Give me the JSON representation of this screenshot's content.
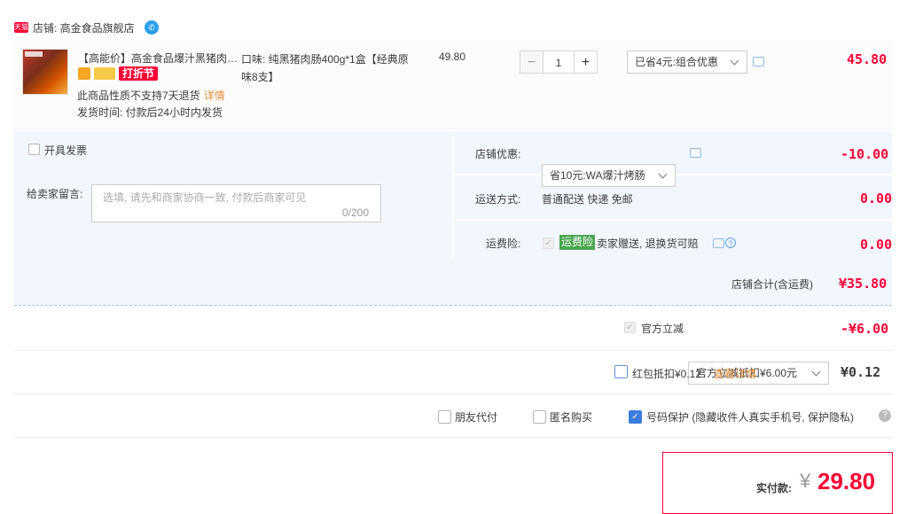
{
  "shop": {
    "badge": "天猫",
    "label": "店铺: 高金食品旗舰店",
    "ww_icon": "ww-chat-icon"
  },
  "item": {
    "title": "【高能价】高金食品爆汁黑猪肉…",
    "festival_tag": "打折节",
    "note_return": "此商品性质不支持7天退货",
    "detail_link": "详情",
    "delivery": "发货时间: 付款后24小时内发货",
    "flavor": "口味: 纯黑猪肉肠400g*1盒【经典原味8支】",
    "unit_price": "49.80",
    "qty_minus": "−",
    "qty": "1",
    "qty_plus": "+",
    "promo_select": "已省4元:组合优惠",
    "subtotal": "45.80"
  },
  "invoice_label": "开具发票",
  "message": {
    "label": "给卖家留言:",
    "placeholder": "选填, 请先和商家协商一致, 付款后商家可见",
    "counter": "0/200"
  },
  "shop_discount": {
    "label": "店铺优惠:",
    "select": "省10元:WA爆汁烤肠",
    "amount": "-10.00"
  },
  "shipping": {
    "label": "运送方式:",
    "value": "普通配送 快递 免邮",
    "amount": "0.00"
  },
  "insurance": {
    "label": "运费险:",
    "tag": "运费险",
    "desc": "卖家赠送, 退换货可赔",
    "amount": "0.00"
  },
  "shop_total": {
    "label": "店铺合计(含运费)",
    "amount": "¥35.80"
  },
  "official": {
    "label": "官方立减",
    "select": "官方立减抵扣¥6.00元",
    "amount": "-¥6.00"
  },
  "redpacket": {
    "label": "红包抵扣¥0.12",
    "link": "查看详情",
    "amount": "¥0.12"
  },
  "options": {
    "friend_pay": "朋友代付",
    "anonymous": "匿名购买",
    "phone_protect": "号码保护 (隐藏收件人真实手机号, 保护隐私)"
  },
  "pay": {
    "label": "实付款:",
    "currency": "¥",
    "amount": "29.80"
  },
  "colors": {
    "accent": "#ff0036",
    "panel": "#f2f7ff",
    "link": "#e38f3a"
  }
}
